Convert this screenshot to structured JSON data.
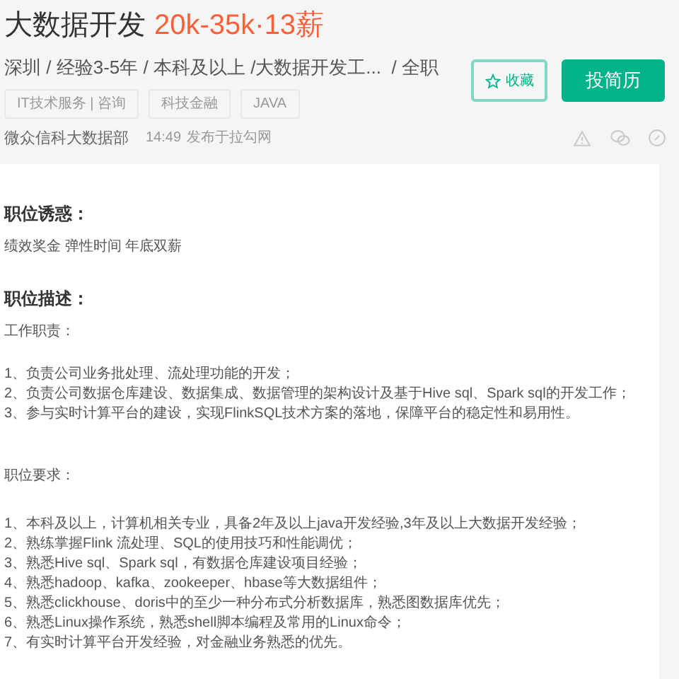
{
  "job": {
    "title": "大数据开发",
    "salary": "20k-35k·13薪",
    "meta": "深圳 / 经验3-5年 / 本科及以上 /大数据开发工...  / 全职",
    "tags": [
      "IT技术服务 | 咨询",
      "科技金融",
      "JAVA"
    ]
  },
  "actions": {
    "favorite": "收藏",
    "apply": "投简历"
  },
  "publisher": {
    "department": "微众信科大数据部",
    "time": "14:49",
    "source": "发布于拉勾网"
  },
  "sections": [
    {
      "heading": "职位诱惑：",
      "groups": [
        {
          "kind": "paragraph",
          "lines": [
            "绩效奖金 弹性时间 年底双薪"
          ]
        }
      ]
    },
    {
      "heading": "职位描述：",
      "groups": [
        {
          "kind": "paragraph",
          "lines": [
            "工作职责："
          ]
        },
        {
          "kind": "paragraph",
          "lines": [
            "1、负责公司业务批处理、流处理功能的开发；",
            "2、负责公司数据仓库建设、数据集成、数据管理的架构设计及基于Hive sql、Spark sql的开发工作；",
            "3、参与实时计算平台的建设，实现FlinkSQL技术方案的落地，保障平台的稳定性和易用性。"
          ]
        },
        {
          "kind": "subheading",
          "lines": [
            "职位要求："
          ]
        },
        {
          "kind": "paragraph",
          "lines": [
            "1、本科及以上，计算机相关专业，具备2年及以上java开发经验,3年及以上大数据开发经验；",
            "2、熟练掌握Flink 流处理、SQL的使用技巧和性能调优；",
            "3、熟悉Hive sql、Spark sql，有数据仓库建设项目经验；",
            "4、熟悉hadoop、kafka、zookeeper、hbase等大数据组件；",
            "5、熟悉clickhouse、doris中的至少一种分布式分析数据库，熟悉图数据库优先；",
            "6、熟悉Linux操作系统，熟悉shell脚本编程及常用的Linux命令；",
            "7、有实时计算平台开发经验，对金融业务熟悉的优先。"
          ]
        }
      ]
    }
  ]
}
